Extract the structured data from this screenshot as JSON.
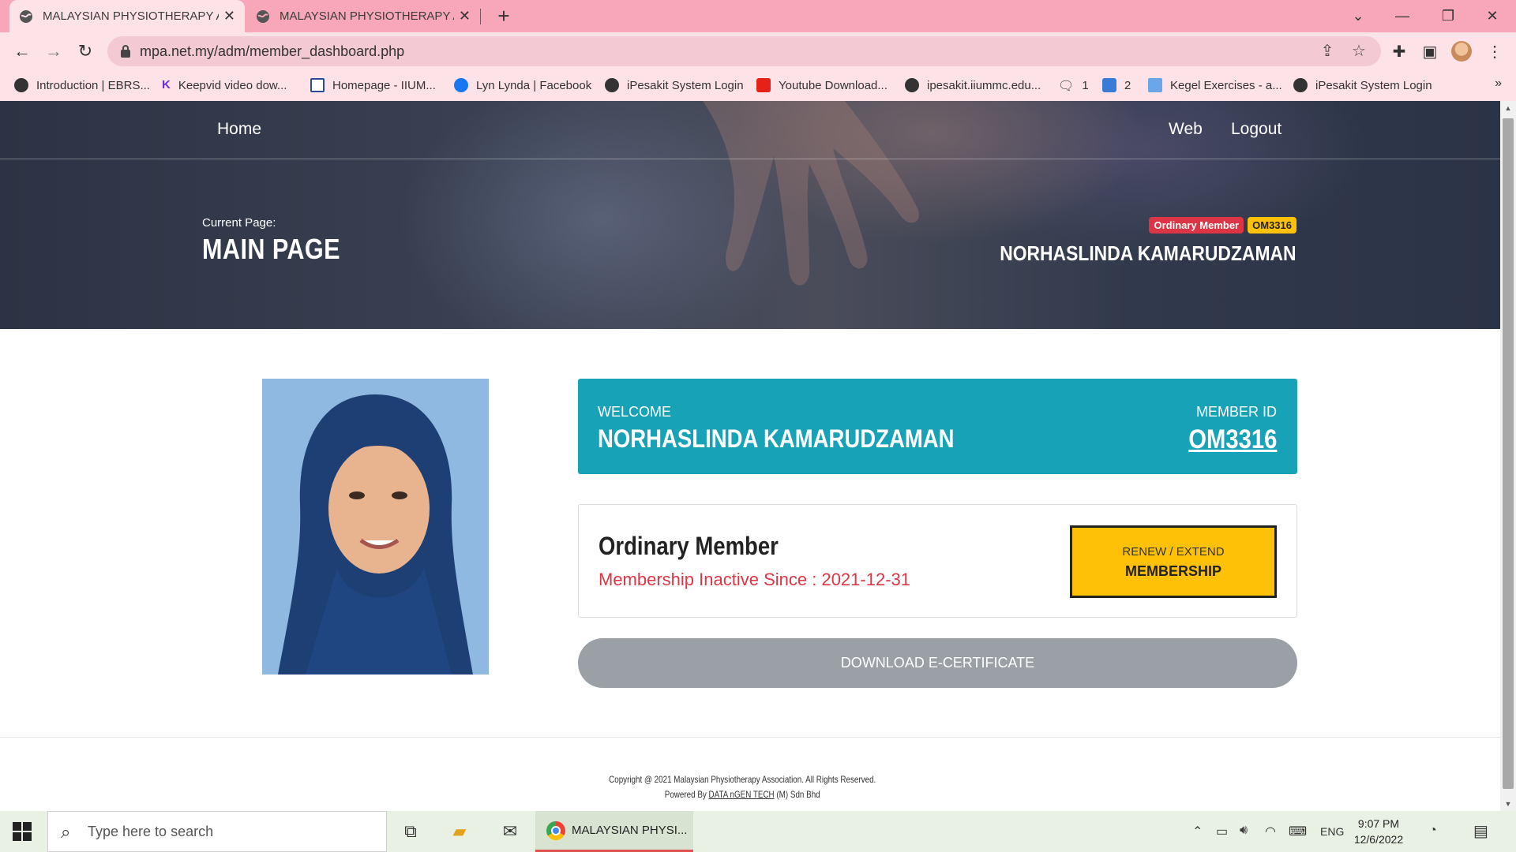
{
  "browser": {
    "tabs": [
      {
        "title": "MALAYSIAN PHYSIOTHERAPY AS",
        "active": true
      },
      {
        "title": "MALAYSIAN PHYSIOTHERAPY AS",
        "active": false
      }
    ],
    "new_tab": "+",
    "address": "mpa.net.my/adm/member_dashboard.php",
    "bookmarks": [
      {
        "label": "Introduction | EBRS...",
        "icon": "globe-icon"
      },
      {
        "label": "Keepvid video dow...",
        "icon": "keepvid-icon"
      },
      {
        "label": "Homepage - IIUM...",
        "icon": "e-icon"
      },
      {
        "label": "Lyn Lynda | Facebook",
        "icon": "facebook-icon"
      },
      {
        "label": "iPesakit System Login",
        "icon": "globe-icon"
      },
      {
        "label": "Youtube Download...",
        "icon": "youtube-icon"
      },
      {
        "label": "ipesakit.iiummc.edu...",
        "icon": "globe-icon"
      },
      {
        "label": "1",
        "icon": "chat-icon"
      },
      {
        "label": "2",
        "icon": "image-icon"
      },
      {
        "label": "Kegel Exercises - a...",
        "icon": "site-icon"
      },
      {
        "label": "iPesakit System Login",
        "icon": "globe-icon"
      }
    ],
    "bookmarks_more": "»"
  },
  "hero": {
    "nav_home": "Home",
    "nav_web": "Web",
    "nav_logout": "Logout",
    "current_label": "Current Page:",
    "current_title": "MAIN PAGE",
    "badge_type": "Ordinary Member",
    "badge_id": "OM3316",
    "member_name": "NORHASLINDA KAMARUDZAMAN"
  },
  "welcome": {
    "label": "WELCOME",
    "name": "NORHASLINDA KAMARUDZAMAN",
    "id_label": "MEMBER ID",
    "id_value": "OM3316"
  },
  "membership": {
    "type": "Ordinary Member",
    "status": "Membership Inactive Since : 2021-12-31",
    "renew_line1": "RENEW / EXTEND",
    "renew_line2": "MEMBERSHIP"
  },
  "certificate_button": "DOWNLOAD E-CERTIFICATE",
  "footer": {
    "copyright": "Copyright @ 2021 Malaysian Physiotherapy Association. All Rights Reserved.",
    "powered_prefix": "Powered By",
    "powered_link": "DATA nGEN TECH",
    "powered_suffix": "(M) Sdn Bhd"
  },
  "taskbar": {
    "search_placeholder": "Type here to search",
    "chrome_label": "MALAYSIAN PHYSI...",
    "language": "ENG",
    "time": "9:07 PM",
    "date": "12/6/2022"
  },
  "colors": {
    "tabstrip": "#f7a7b8",
    "welcome_bg": "#17a2b8",
    "renew_bg": "#ffc107",
    "inactive_text": "#dc3545",
    "cert_button": "#9aa0a6"
  }
}
